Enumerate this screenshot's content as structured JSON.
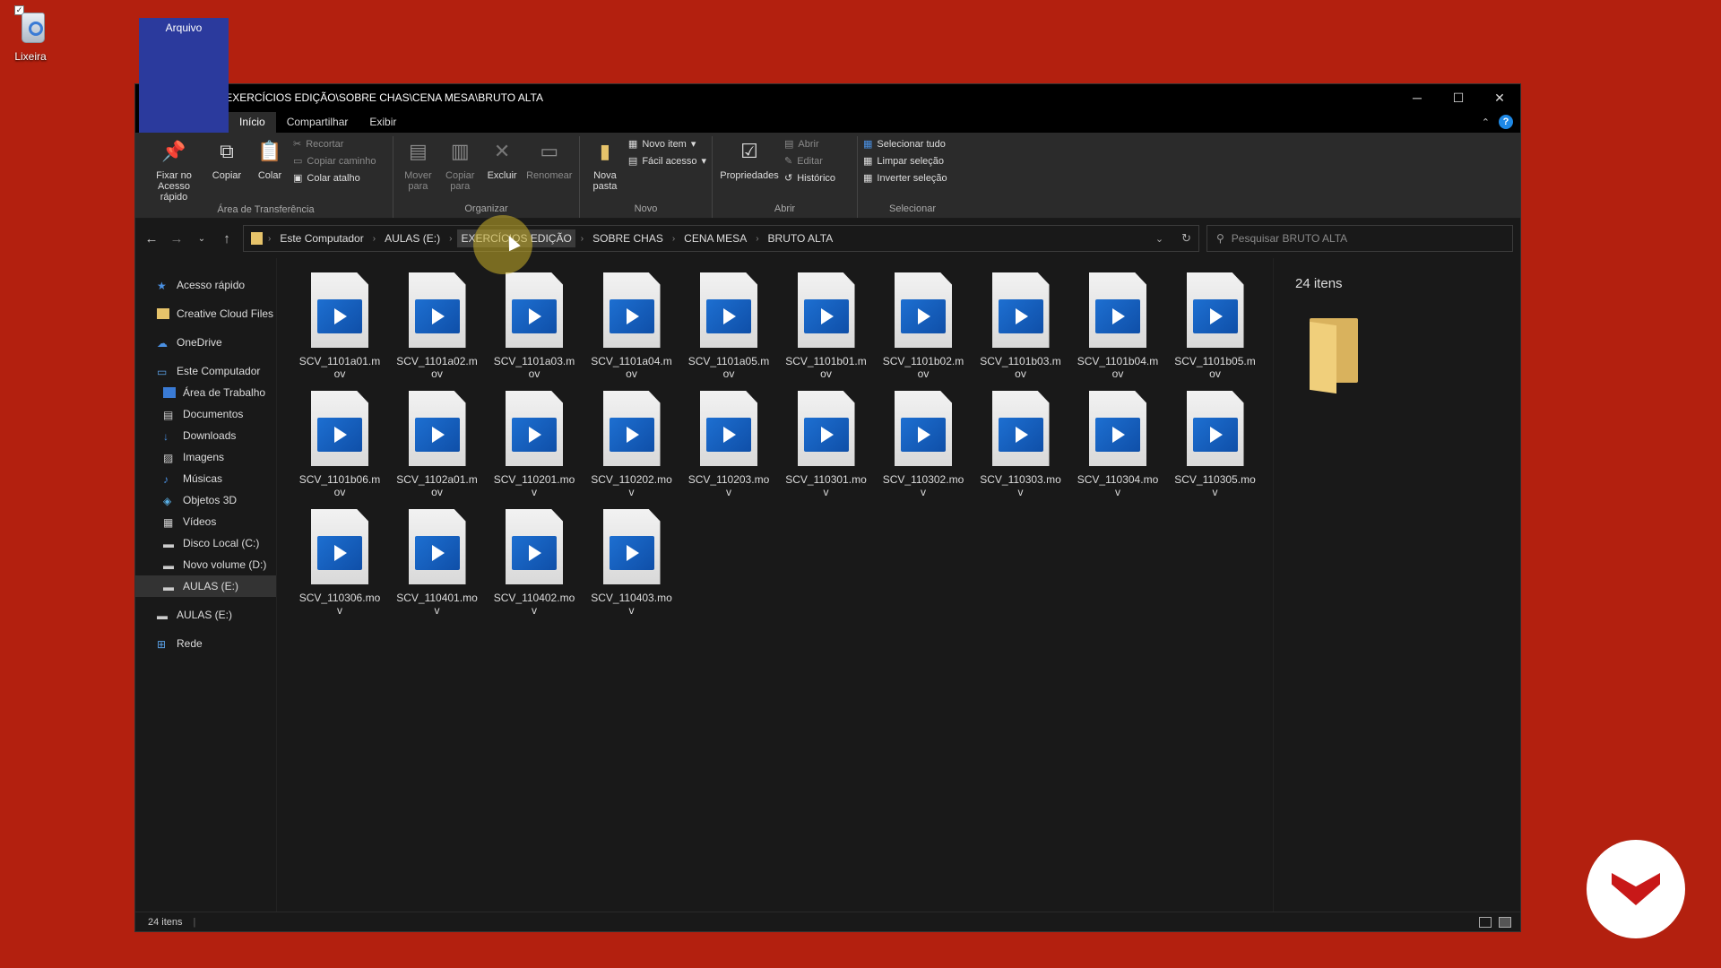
{
  "desktop": {
    "recycle_bin_label": "Lixeira"
  },
  "window": {
    "title_path": "E:\\EXERCÍCIOS EDIÇÃO\\SOBRE CHAS\\CENA MESA\\BRUTO ALTA",
    "controls": {
      "minimize": "─",
      "maximize": "☐",
      "close": "✕"
    }
  },
  "tabs": {
    "file": "Arquivo",
    "home": "Início",
    "share": "Compartilhar",
    "view": "Exibir"
  },
  "ribbon": {
    "clipboard": {
      "label": "Área de Transferência",
      "pin": "Fixar no Acesso rápido",
      "copy": "Copiar",
      "paste": "Colar",
      "cut": "Recortar",
      "copy_path": "Copiar caminho",
      "paste_shortcut": "Colar atalho"
    },
    "organize": {
      "label": "Organizar",
      "move": "Mover para",
      "copy_to": "Copiar para",
      "delete": "Excluir",
      "rename": "Renomear"
    },
    "new": {
      "label": "Novo",
      "new_folder": "Nova pasta",
      "new_item": "Novo item",
      "easy_access": "Fácil acesso"
    },
    "open": {
      "label": "Abrir",
      "properties": "Propriedades",
      "open": "Abrir",
      "edit": "Editar",
      "history": "Histórico"
    },
    "select": {
      "label": "Selecionar",
      "select_all": "Selecionar tudo",
      "select_none": "Limpar seleção",
      "invert": "Inverter seleção"
    }
  },
  "address": {
    "crumbs": [
      "Este Computador",
      "AULAS (E:)",
      "EXERCÍCIOS EDIÇÃO",
      "SOBRE CHAS",
      "CENA MESA",
      "BRUTO ALTA"
    ],
    "search_placeholder": "Pesquisar BRUTO ALTA"
  },
  "sidebar": {
    "items": [
      "Acesso rápido",
      "Creative Cloud Files",
      "OneDrive",
      "Este Computador",
      "Área de Trabalho",
      "Documentos",
      "Downloads",
      "Imagens",
      "Músicas",
      "Objetos 3D",
      "Vídeos",
      "Disco Local (C:)",
      "Novo volume (D:)",
      "AULAS (E:)",
      "AULAS (E:)",
      "Rede"
    ]
  },
  "files": [
    "SCV_1101a01.mov",
    "SCV_1101a02.mov",
    "SCV_1101a03.mov",
    "SCV_1101a04.mov",
    "SCV_1101a05.mov",
    "SCV_1101b01.mov",
    "SCV_1101b02.mov",
    "SCV_1101b03.mov",
    "SCV_1101b04.mov",
    "SCV_1101b05.mov",
    "SCV_1101b06.mov",
    "SCV_1102a01.mov",
    "SCV_110201.mov",
    "SCV_110202.mov",
    "SCV_110203.mov",
    "SCV_110301.mov",
    "SCV_110302.mov",
    "SCV_110303.mov",
    "SCV_110304.mov",
    "SCV_110305.mov",
    "SCV_110306.mov",
    "SCV_110401.mov",
    "SCV_110402.mov",
    "SCV_110403.mov"
  ],
  "details": {
    "count": "24 itens"
  },
  "status": {
    "count": "24 itens"
  }
}
